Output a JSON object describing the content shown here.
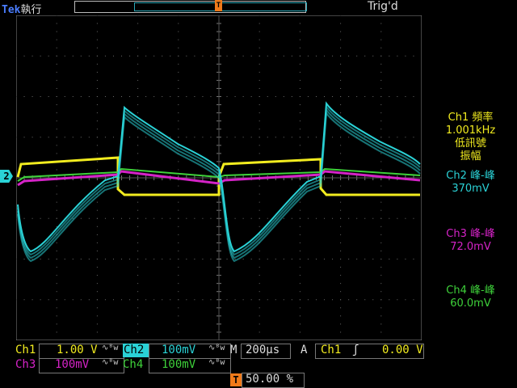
{
  "header": {
    "brand": "Tek",
    "mode": "執行",
    "trigger_status": "Trig'd",
    "trigger_marker": "T"
  },
  "channels": {
    "ch1": {
      "name": "Ch1",
      "scale": "1.00 V",
      "color": "#f2ec1f"
    },
    "ch2": {
      "name": "Ch2",
      "scale": "100mV",
      "color": "#2ad2d6",
      "marker": "2"
    },
    "ch3": {
      "name": "Ch3",
      "scale": "100mV",
      "color": "#d523c7"
    },
    "ch4": {
      "name": "Ch4",
      "scale": "100mV",
      "color": "#3ed23a"
    }
  },
  "timebase": {
    "label": "M",
    "value": "200µs"
  },
  "trigger": {
    "mode": "A",
    "source": "Ch1",
    "slope": "ʃ",
    "level": "0.00 V",
    "position_label": "T",
    "position": "50.00 %"
  },
  "measurements": [
    {
      "title": "Ch1 頻率",
      "value": "1.001kHz",
      "note1": "低訊號",
      "note2": "振幅",
      "color": "#f2ec1f"
    },
    {
      "title": "Ch2 峰-峰",
      "value": "370mV",
      "color": "#2ad2d6"
    },
    {
      "title": "Ch3 峰-峰",
      "value": "72.0mV",
      "color": "#d523c7"
    },
    {
      "title": "Ch4 峰-峰",
      "value": "60.0mV",
      "color": "#3ed23a"
    }
  ]
}
